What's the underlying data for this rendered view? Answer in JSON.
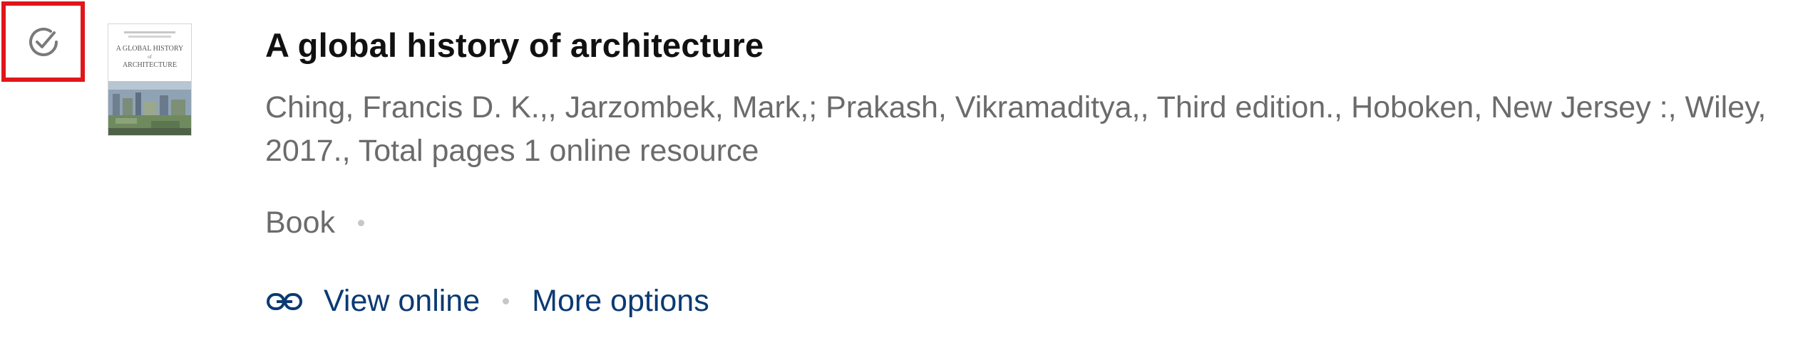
{
  "record": {
    "selected": true,
    "title": "A global history of architecture",
    "citation": "Ching, Francis D. K.,, Jarzombek, Mark,; Prakash, Vikramaditya,, Third edition., Hoboken, New Jersey :, Wiley, 2017., Total pages 1 online resource",
    "format": "Book",
    "thumbnail": {
      "title_line1": "A GLOBAL HISTORY",
      "title_line2": "of",
      "title_line3": "ARCHITECTURE"
    }
  },
  "actions": {
    "view_online": "View online",
    "more_options": "More options"
  },
  "colors": {
    "selection_border": "#e0161b",
    "title": "#111111",
    "secondary_text": "#6b6b6b",
    "link": "#0b3a72",
    "separator_dot": "#c7c7c7"
  },
  "icons": {
    "select": "check-circle-icon",
    "view_online": "link-icon"
  }
}
